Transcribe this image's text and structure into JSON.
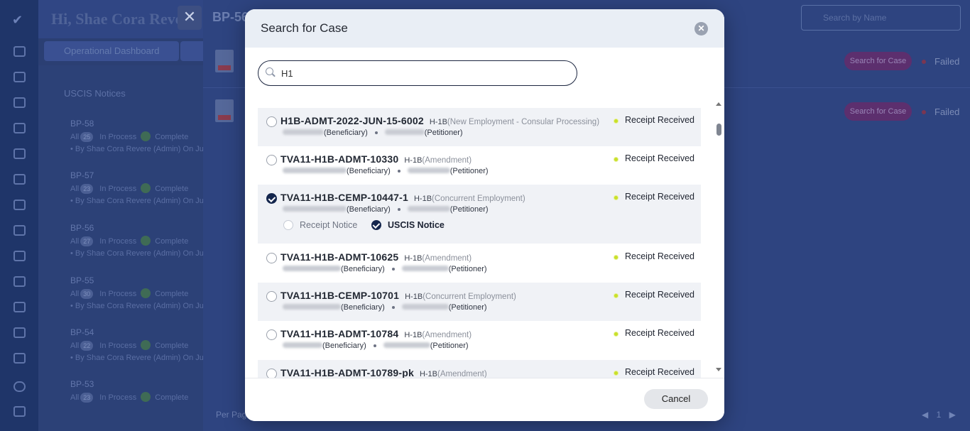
{
  "background": {
    "greeting": "Hi, Shae Cora Reve",
    "tabs": [
      "Operational Dashboard"
    ],
    "section_title": "USCIS Notices",
    "bp_list": [
      {
        "title": "BP-58",
        "all": "All",
        "count": "25",
        "in_process": "In Process",
        "completed": "Complete",
        "by": "• By Shae Cora Revere (Admin) On Jul"
      },
      {
        "title": "BP-57",
        "all": "All",
        "count": "23",
        "in_process": "In Process",
        "completed": "Complete",
        "by": "• By Shae Cora Revere (Admin) On Jul"
      },
      {
        "title": "BP-56",
        "all": "All",
        "count": "27",
        "in_process": "In Process",
        "completed": "Complete",
        "by": "• By Shae Cora Revere (Admin) On Jul"
      },
      {
        "title": "BP-55",
        "all": "All",
        "count": "30",
        "in_process": "In Process",
        "completed": "Complete",
        "by": "• By Shae Cora Revere (Admin) On Jul"
      },
      {
        "title": "BP-54",
        "all": "All",
        "count": "22",
        "in_process": "In Process",
        "completed": "Complete",
        "by": "• By Shae Cora Revere (Admin) On Jul"
      },
      {
        "title": "BP-53",
        "all": "All",
        "count": "23",
        "in_process": "In Process",
        "completed": "Complete",
        "by": ""
      }
    ],
    "panel_title": "BP-56",
    "search_placeholder": "Search by Name",
    "rows": [
      {
        "button": "Search for Case",
        "status": "Failed"
      },
      {
        "button": "Search for Case",
        "status": "Failed"
      }
    ],
    "per_page": "Per Page",
    "page_number": "1"
  },
  "modal": {
    "title": "Search for Case",
    "search_value": "H1",
    "cancel_label": "Cancel",
    "beneficiary_suffix": "(Beneficiary)",
    "petitioner_suffix": "(Petitioner)",
    "cases": [
      {
        "id": "H1B-ADMT-2022-JUN-15-6002",
        "visa": "H-1B",
        "sub": "(New Employment - Consular Processing)",
        "status": "Receipt Received",
        "selected": false
      },
      {
        "id": "TVA11-H1B-ADMT-10330",
        "visa": "H-1B",
        "sub": "(Amendment)",
        "status": "Receipt Received",
        "selected": false
      },
      {
        "id": "TVA11-H1B-CEMP-10447-1",
        "visa": "H-1B",
        "sub": "(Concurrent Employment)",
        "status": "Receipt Received",
        "selected": true,
        "documents": [
          {
            "label": "Receipt Notice",
            "checked": false
          },
          {
            "label": "USCIS Notice",
            "checked": true
          }
        ]
      },
      {
        "id": "TVA11-H1B-ADMT-10625",
        "visa": "H-1B",
        "sub": "(Amendment)",
        "status": "Receipt Received",
        "selected": false
      },
      {
        "id": "TVA11-H1B-CEMP-10701",
        "visa": "H-1B",
        "sub": "(Concurrent Employment)",
        "status": "Receipt Received",
        "selected": false
      },
      {
        "id": "TVA11-H1B-ADMT-10784",
        "visa": "H-1B",
        "sub": "(Amendment)",
        "status": "Receipt Received",
        "selected": false
      },
      {
        "id": "TVA11-H1B-ADMT-10789-pk",
        "visa": "H-1B",
        "sub": "(Amendment)",
        "status": "Receipt Received",
        "selected": false
      }
    ]
  },
  "colors": {
    "overlay": "#2b3f73",
    "modal_header": "#e9eef5",
    "checked": "#14264d",
    "status_dot": "#c9e02a",
    "failed_dot": "#7a3652"
  }
}
